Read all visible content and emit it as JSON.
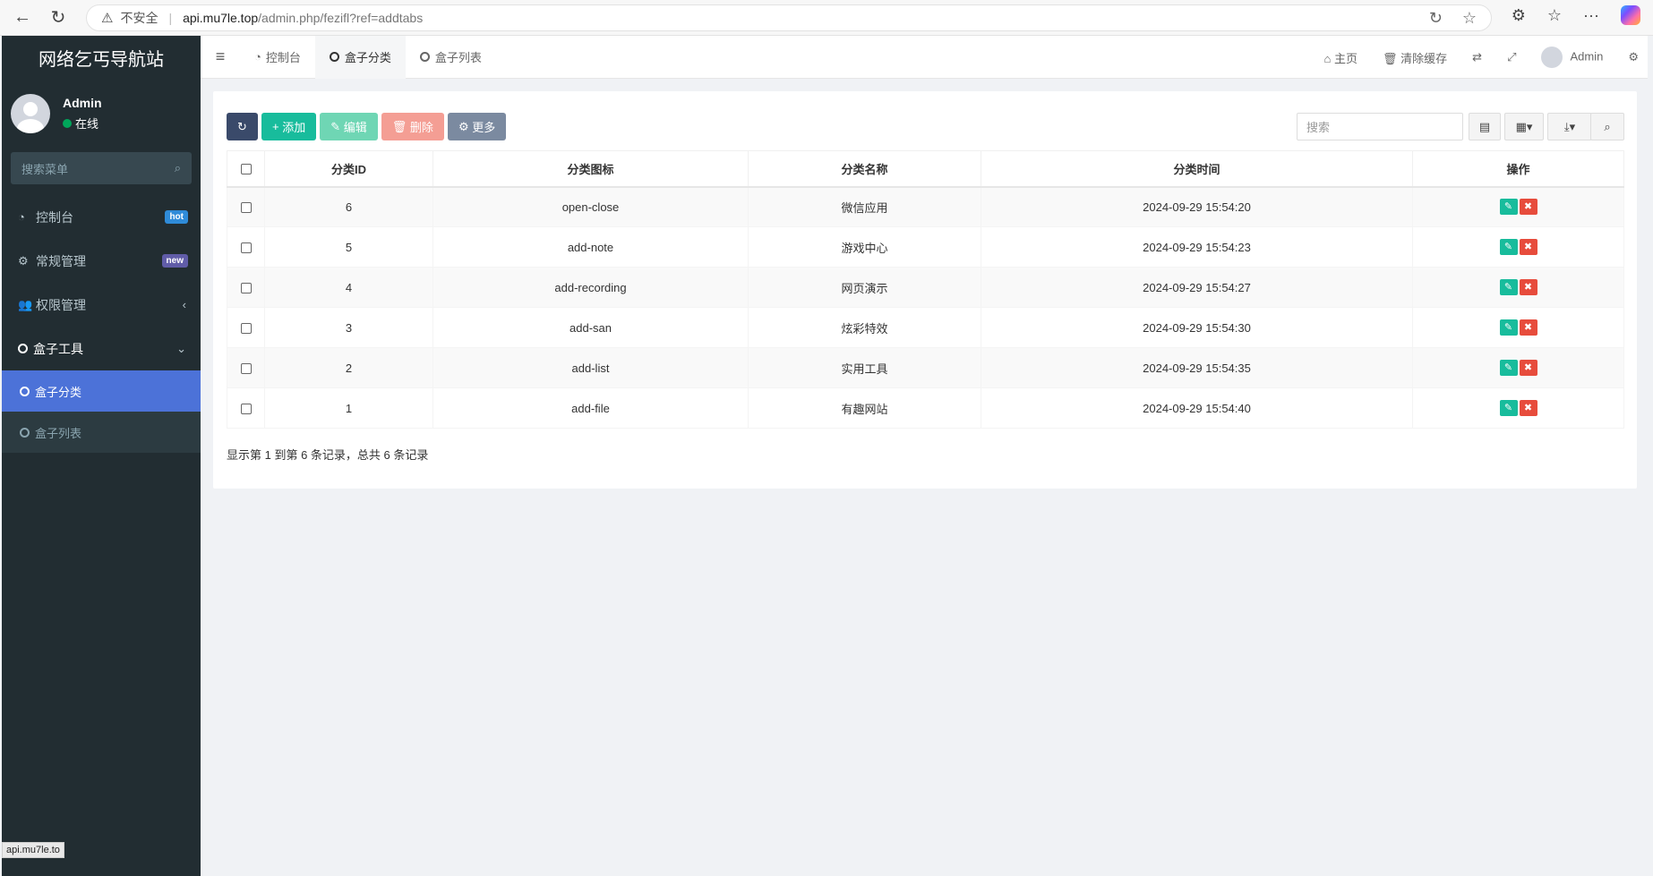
{
  "browser": {
    "back_icon": "back-arrow-icon",
    "refresh_icon": "refresh-icon",
    "insecure_label": "不安全",
    "url_host": "api.mu7le.top",
    "url_path": "/admin.php/fezifl?ref=addtabs",
    "status_url": "api.mu7le.to"
  },
  "sidebar": {
    "site_title": "网络乞丐导航站",
    "user_name": "Admin",
    "user_status": "在线",
    "search_placeholder": "搜索菜单",
    "menu": [
      {
        "label": "控制台",
        "icon": "dashboard-icon",
        "badge": "hot"
      },
      {
        "label": "常规管理",
        "icon": "cogs-icon",
        "badge": "new"
      },
      {
        "label": "权限管理",
        "icon": "users-icon",
        "chevron": "‹"
      },
      {
        "label": "盒子工具",
        "icon": "circle-icon",
        "chevron": "⌄"
      }
    ],
    "submenu": [
      {
        "label": "盒子分类",
        "active": true
      },
      {
        "label": "盒子列表",
        "active": false
      }
    ]
  },
  "topnav": {
    "tabs": [
      "控制台",
      "盒子分类",
      "盒子列表"
    ],
    "home": "主页",
    "clear_cache": "清除缓存",
    "admin": "Admin"
  },
  "toolbar": {
    "add": "添加",
    "edit": "编辑",
    "delete": "删除",
    "more": "更多",
    "search_placeholder": "搜索"
  },
  "table": {
    "headers": [
      "分类ID",
      "分类图标",
      "分类名称",
      "分类时间",
      "操作"
    ],
    "rows": [
      {
        "id": "6",
        "icon": "open-close",
        "name": "微信应用",
        "time": "2024-09-29 15:54:20"
      },
      {
        "id": "5",
        "icon": "add-note",
        "name": "游戏中心",
        "time": "2024-09-29 15:54:23"
      },
      {
        "id": "4",
        "icon": "add-recording",
        "name": "网页演示",
        "time": "2024-09-29 15:54:27"
      },
      {
        "id": "3",
        "icon": "add-san",
        "name": "炫彩特效",
        "time": "2024-09-29 15:54:30"
      },
      {
        "id": "2",
        "icon": "add-list",
        "name": "实用工具",
        "time": "2024-09-29 15:54:35"
      },
      {
        "id": "1",
        "icon": "add-file",
        "name": "有趣网站",
        "time": "2024-09-29 15:54:40"
      }
    ]
  },
  "summary": "显示第 1 到第 6 条记录，总共 6 条记录"
}
